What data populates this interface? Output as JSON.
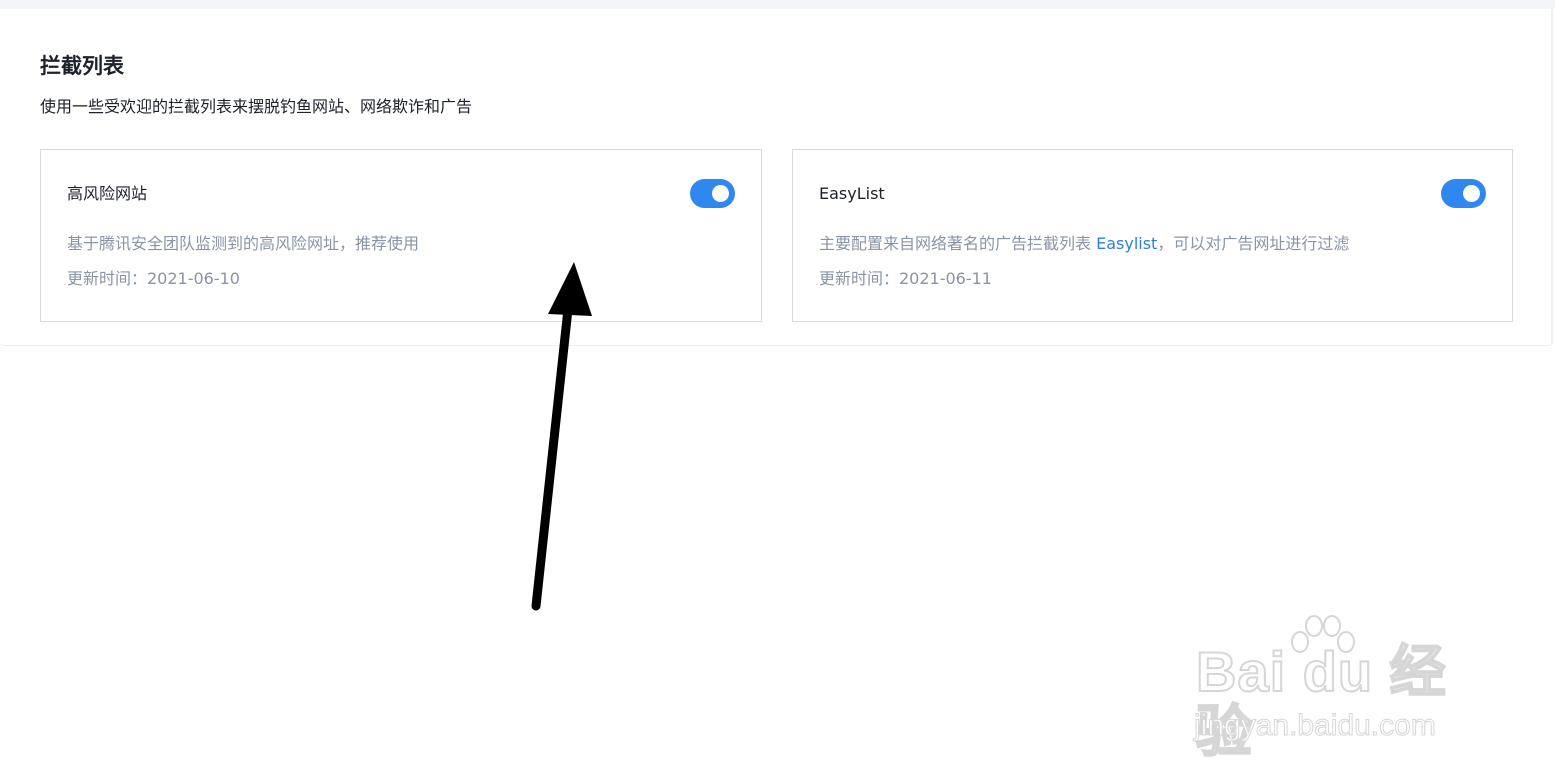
{
  "section": {
    "title": "拦截列表",
    "subtitle": "使用一些受欢迎的拦截列表来摆脱钓鱼网站、网络欺诈和广告"
  },
  "cards": [
    {
      "name": "高风险网站",
      "description": "基于腾讯安全团队监测到的高风险网址，推荐使用",
      "updated": "更新时间：2021-06-10",
      "enabled": true
    },
    {
      "name": "EasyList",
      "description_prefix": "主要配置来自网络著名的广告拦截列表 ",
      "description_link": "Easylist",
      "description_suffix": "，可以对广告网址进行过滤",
      "updated": "更新时间：2021-06-11",
      "enabled": true
    }
  ],
  "watermark": {
    "brand": "Bai du 经验",
    "url": "jingyan.baidu.com"
  },
  "colors": {
    "toggle_on": "#2f88f0",
    "link": "#2d7ee0",
    "muted_text": "#8a94a6",
    "primary_text": "#1d2129",
    "arrow": "#000000"
  }
}
